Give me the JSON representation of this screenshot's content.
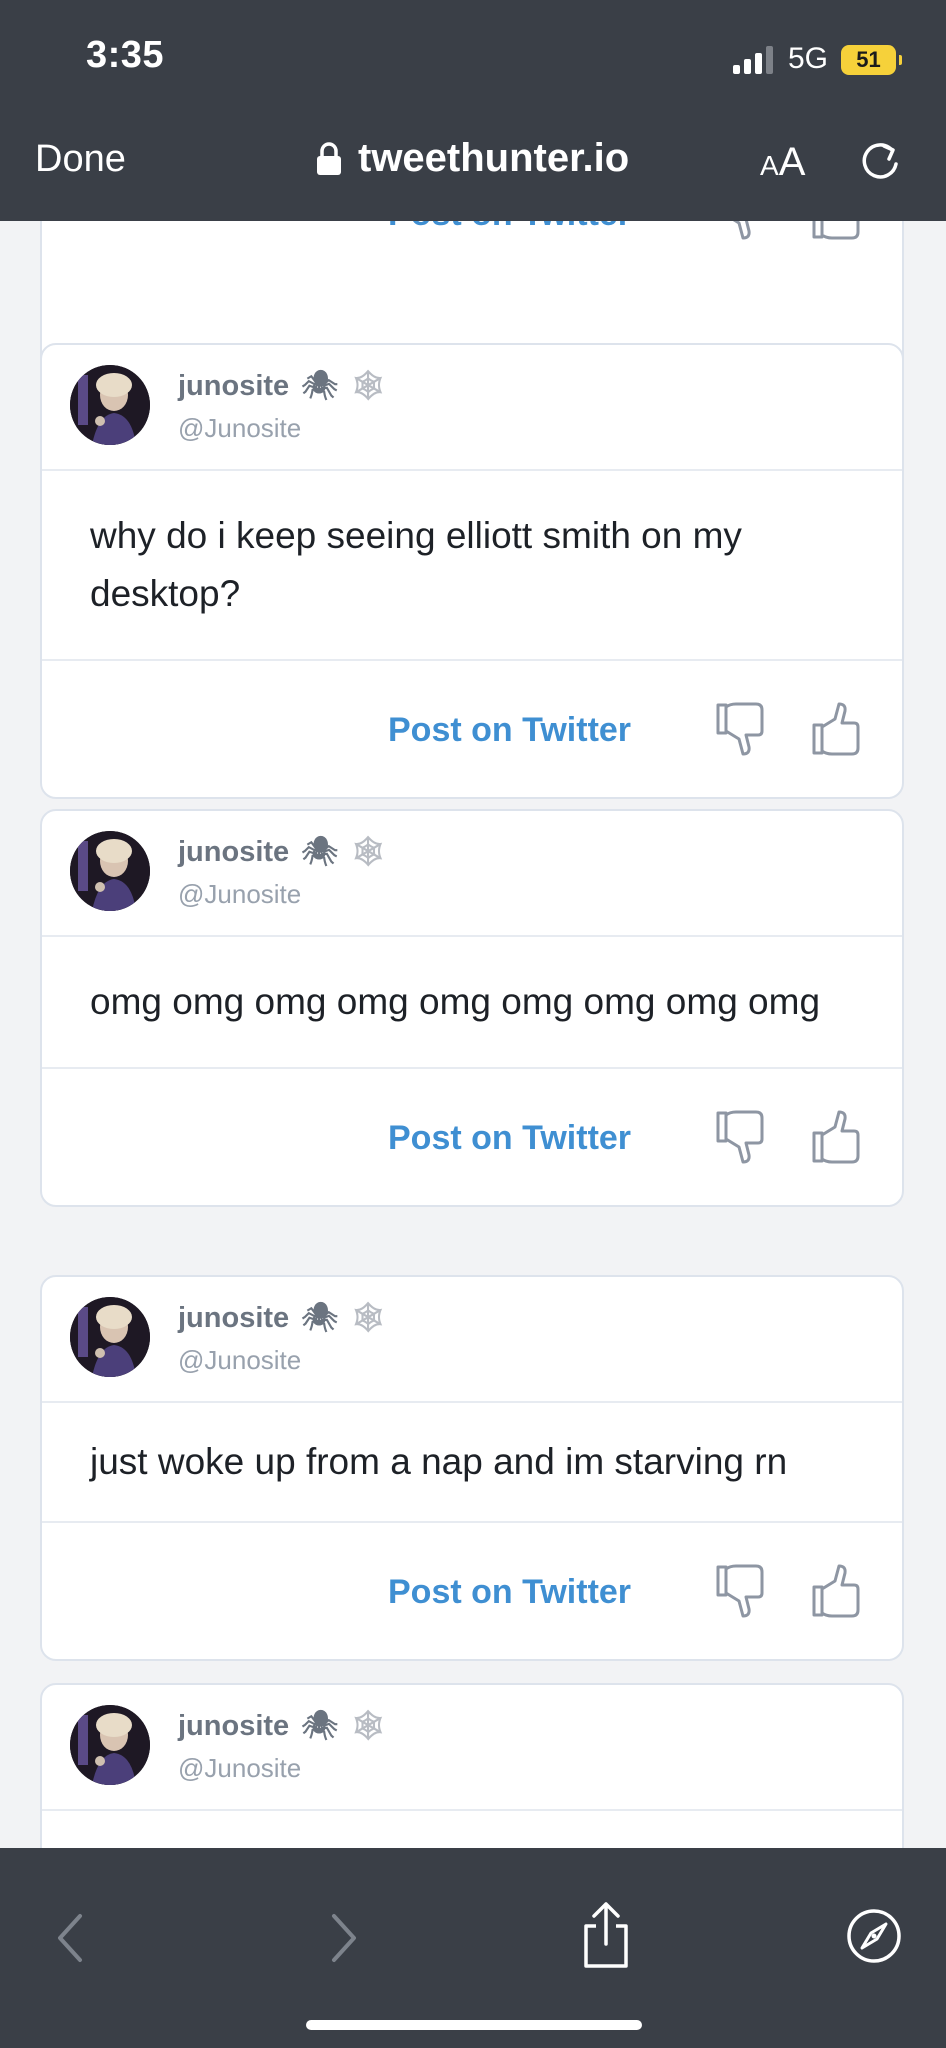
{
  "status_bar": {
    "time": "3:35",
    "network": "5G",
    "battery": "51"
  },
  "browser": {
    "done_label": "Done",
    "url": "tweethunter.io",
    "text_size_small": "A",
    "text_size_large": "A"
  },
  "tweets": [
    {
      "name": "junosite",
      "emoji1": "🕷",
      "emoji2": "🕸",
      "handle": "@Junosite",
      "text": "",
      "post_label": "Post on Twitter"
    },
    {
      "name": "junosite",
      "emoji1": "🕷",
      "emoji2": "🕸",
      "handle": "@Junosite",
      "text": "why do i keep seeing elliott smith on my desktop?",
      "post_label": "Post on Twitter"
    },
    {
      "name": "junosite",
      "emoji1": "🕷",
      "emoji2": "🕸",
      "handle": "@Junosite",
      "text": "omg omg omg omg omg omg omg omg omg",
      "post_label": "Post on Twitter"
    },
    {
      "name": "junosite",
      "emoji1": "🕷",
      "emoji2": "🕸",
      "handle": "@Junosite",
      "text": "just woke up from a nap and im starving rn",
      "post_label": "Post on Twitter"
    },
    {
      "name": "junosite",
      "emoji1": "🕷",
      "emoji2": "🕸",
      "handle": "@Junosite",
      "text": "",
      "post_label": ""
    }
  ],
  "colors": {
    "chrome": "#3a3f47",
    "link": "#3f8fd2",
    "battery": "#f6d13a",
    "card_border": "#dde3ec"
  },
  "icons": {
    "lock": "lock-icon",
    "reload": "reload-icon",
    "thumb_down": "thumbs-down-icon",
    "thumb_up": "thumbs-up-icon",
    "back": "chevron-left-icon",
    "forward": "chevron-right-icon",
    "share": "share-icon",
    "compass": "compass-icon"
  }
}
